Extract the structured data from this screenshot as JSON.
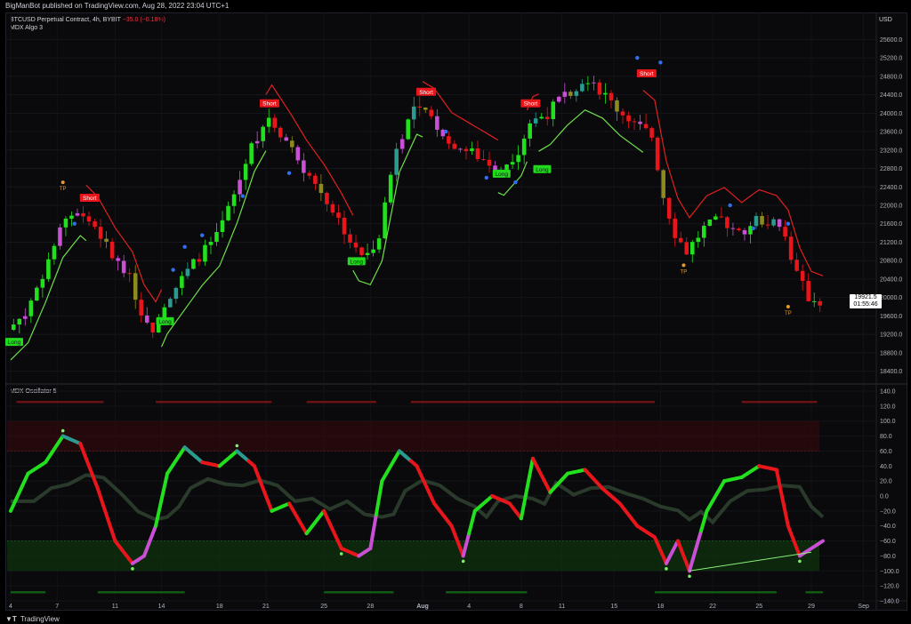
{
  "header": {
    "published_by": "BigManBot published on TradingView.com, Aug 28, 2022 23:04 UTC+1"
  },
  "main_pane": {
    "symbol_title": "BTCUSD Perpetual Contract, 4h, BYBIT",
    "change_text": "−35.0 (−0.18%)",
    "indicator_label": "MDX Algo 3",
    "currency": "USD",
    "last_price": "19921.5",
    "countdown": "01:55:46"
  },
  "osc_pane": {
    "indicator_label": "MDX Oscillator 5"
  },
  "footer": {
    "brand": "TradingView"
  },
  "colors": {
    "bull": "#22e01e",
    "bear": "#e8161b",
    "pink": "#c94fd4",
    "olive": "#8d8a1e",
    "teal": "#2a9b8e",
    "trail_bull": "#6ee04a",
    "trail_bear": "#e02020",
    "dot_blue": "#2f6ff0",
    "tp_orange": "#e89a2a"
  },
  "chart_data": [
    {
      "type": "candlestick",
      "ylim": [
        18200,
        25800
      ],
      "y_ticks": [
        "25600.0",
        "25200.0",
        "24800.0",
        "24400.0",
        "24000.0",
        "23600.0",
        "23200.0",
        "22800.0",
        "22400.0",
        "22000.0",
        "21600.0",
        "21200.0",
        "20800.0",
        "20400.0",
        "20000.0",
        "19600.0",
        "19200.0",
        "18800.0",
        "18400.0"
      ],
      "x_ticks": [
        "4",
        "7",
        "11",
        "14",
        "18",
        "21",
        "25",
        "28",
        "Aug",
        "4",
        "8",
        "11",
        "15",
        "18",
        "22",
        "25",
        "29",
        "Sep"
      ],
      "price_path": [
        [
          0,
          19300
        ],
        [
          3,
          19650
        ],
        [
          6,
          20500
        ],
        [
          9,
          21450
        ],
        [
          12,
          21900
        ],
        [
          15,
          21550
        ],
        [
          18,
          20900
        ],
        [
          21,
          20400
        ],
        [
          23,
          19700
        ],
        [
          25,
          19350
        ],
        [
          27,
          19900
        ],
        [
          30,
          20400
        ],
        [
          33,
          20900
        ],
        [
          36,
          21300
        ],
        [
          39,
          22200
        ],
        [
          42,
          23300
        ],
        [
          45,
          23950
        ],
        [
          48,
          23400
        ],
        [
          51,
          22800
        ],
        [
          54,
          22300
        ],
        [
          57,
          21700
        ],
        [
          60,
          21000
        ],
        [
          62,
          20900
        ],
        [
          64,
          21400
        ],
        [
          67,
          23300
        ],
        [
          70,
          24100
        ],
        [
          73,
          23900
        ],
        [
          76,
          23400
        ],
        [
          79,
          23200
        ],
        [
          82,
          23000
        ],
        [
          85,
          22800
        ],
        [
          88,
          23200
        ],
        [
          90,
          23800
        ],
        [
          93,
          24000
        ],
        [
          96,
          24400
        ],
        [
          99,
          24700
        ],
        [
          102,
          24500
        ],
        [
          105,
          24100
        ],
        [
          108,
          23800
        ],
        [
          111,
          23500
        ],
        [
          113,
          22200
        ],
        [
          115,
          21400
        ],
        [
          117,
          21000
        ],
        [
          120,
          21500
        ],
        [
          123,
          21700
        ],
        [
          126,
          21400
        ],
        [
          129,
          21700
        ],
        [
          132,
          21600
        ],
        [
          134,
          21300
        ],
        [
          136,
          20500
        ],
        [
          138,
          20000
        ],
        [
          140,
          19920
        ]
      ],
      "signals": [
        {
          "label": "Long",
          "at": 0,
          "price": 19200
        },
        {
          "label": "Short",
          "at": 13,
          "price": 22000
        },
        {
          "label": "Long",
          "at": 26,
          "price": 19650
        },
        {
          "label": "Short",
          "at": 44,
          "price": 24050
        },
        {
          "label": "Long",
          "at": 59,
          "price": 20950
        },
        {
          "label": "Short",
          "at": 71,
          "price": 24300
        },
        {
          "label": "Short",
          "at": 89,
          "price": 24050
        },
        {
          "label": "Long",
          "at": 84,
          "price": 22850
        },
        {
          "label": "Long",
          "at": 91,
          "price": 22950
        },
        {
          "label": "Short",
          "at": 109,
          "price": 24700
        }
      ],
      "tp_markers": [
        {
          "label": "TP",
          "at": 9,
          "price": 22500
        },
        {
          "label": "TP",
          "at": 116,
          "price": 20700
        },
        {
          "label": "TP",
          "at": 134,
          "price": 19800
        }
      ]
    },
    {
      "type": "line",
      "ylim": [
        -140,
        140
      ],
      "y_ticks": [
        "140.0",
        "120.0",
        "100.0",
        "80.0",
        "60.0",
        "40.0",
        "20.0",
        "0.0",
        "−20.0",
        "−40.0",
        "−60.0",
        "−80.0",
        "−100.0",
        "−120.0",
        "−140.0"
      ],
      "oscillator": [
        [
          0,
          -20
        ],
        [
          3,
          30
        ],
        [
          6,
          45
        ],
        [
          9,
          80
        ],
        [
          12,
          70
        ],
        [
          15,
          10
        ],
        [
          18,
          -60
        ],
        [
          21,
          -90
        ],
        [
          23,
          -80
        ],
        [
          25,
          -40
        ],
        [
          27,
          30
        ],
        [
          30,
          65
        ],
        [
          33,
          45
        ],
        [
          36,
          40
        ],
        [
          39,
          60
        ],
        [
          42,
          40
        ],
        [
          45,
          -20
        ],
        [
          48,
          -10
        ],
        [
          51,
          -50
        ],
        [
          54,
          -20
        ],
        [
          57,
          -70
        ],
        [
          60,
          -80
        ],
        [
          62,
          -70
        ],
        [
          64,
          20
        ],
        [
          67,
          60
        ],
        [
          70,
          40
        ],
        [
          73,
          -10
        ],
        [
          76,
          -40
        ],
        [
          78,
          -80
        ],
        [
          80,
          -20
        ],
        [
          83,
          0
        ],
        [
          86,
          -10
        ],
        [
          88,
          -30
        ],
        [
          90,
          50
        ],
        [
          93,
          5
        ],
        [
          96,
          30
        ],
        [
          99,
          35
        ],
        [
          102,
          10
        ],
        [
          105,
          -10
        ],
        [
          108,
          -40
        ],
        [
          111,
          -55
        ],
        [
          113,
          -90
        ],
        [
          115,
          -60
        ],
        [
          117,
          -100
        ],
        [
          120,
          -20
        ],
        [
          123,
          20
        ],
        [
          126,
          25
        ],
        [
          129,
          40
        ],
        [
          132,
          35
        ],
        [
          134,
          -40
        ],
        [
          136,
          -80
        ],
        [
          138,
          -70
        ],
        [
          140,
          -60
        ]
      ]
    }
  ]
}
